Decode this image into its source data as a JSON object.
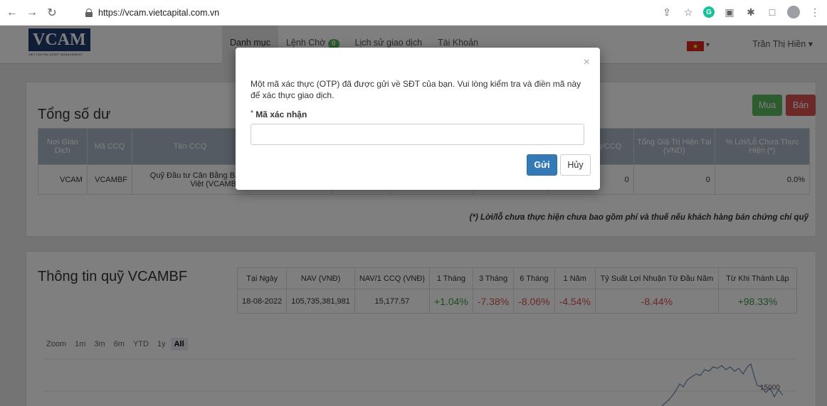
{
  "browser": {
    "url": "https://vcam.vietcapital.com.vn",
    "icons": [
      "back-icon",
      "forward-icon",
      "reload-icon",
      "share-icon",
      "star-icon",
      "grammarly-icon",
      "extension-icon",
      "puzzle-icon",
      "sidebar-icon",
      "profile-icon",
      "menu-icon"
    ]
  },
  "navbar": {
    "logo": "VCAM",
    "logo_tagline": "VIET CAPITAL ASSET MANAGEMENT",
    "menu": [
      {
        "label": "Danh mục"
      },
      {
        "label": "Lệnh Chờ",
        "badge": "0"
      },
      {
        "label": "Lịch sử giao dịch"
      },
      {
        "label": "Tài Khoản"
      }
    ],
    "user_name": "Trần Thị Hiền"
  },
  "balance": {
    "title": "Tổng số dư",
    "buy_label": "Mua",
    "sell_label": "Bán",
    "headers": [
      "Nơi Giao Dịch",
      "Mã CCQ",
      "Tên CCQ",
      "",
      "",
      "",
      "",
      "Giá Trị TS g/CCQ",
      "Tổng Giá Trị Hiện Tại (VND)",
      "% Lời/Lỗ Chưa Thực Hiện (*)"
    ],
    "rows": [
      [
        "VCAM",
        "VCAMBF",
        "Quỹ Đầu tư Cân Bằng Bản Việt (VCAMBF)",
        "",
        "",
        "",
        "",
        "0",
        "0",
        "0.0%"
      ]
    ],
    "note": "(*) Lời/lỗ chưa thực hiện chưa bao gồm phí và thuế nếu khách hàng bán chứng chỉ quỹ"
  },
  "fund_info": {
    "title": "Thông tin quỹ VCAMBF",
    "headers": [
      "Tại Ngày",
      "NAV (VNĐ)",
      "NAV/1 CCQ (VNĐ)",
      "1 Tháng",
      "3 Tháng",
      "6 Tháng",
      "1 Năm",
      "Tỷ Suất Lợi Nhuận Từ Đầu Năm",
      "Từ Khi Thành Lập"
    ],
    "row": {
      "date": "18-08-2022",
      "nav": "105,735,381,981",
      "nav_per": "15,177.57",
      "m1": "+1.04%",
      "m3": "-7.38%",
      "m6": "-8.06%",
      "y1": "-4.54%",
      "ytd": "-8.44%",
      "inception": "+98.33%"
    },
    "zoom_label": "Zoom",
    "zoom_options": [
      "1m",
      "3m",
      "6m",
      "YTD",
      "1y",
      "All"
    ],
    "chart_tick": "15000"
  },
  "modal": {
    "message": "Một mã xác thực (OTP) đã được gửi về SĐT của bạn. Vui lòng kiểm tra và điền mã này để xác thực giao dịch.",
    "required_mark": "*",
    "field_label": "Mã xác nhận",
    "otp_value": "",
    "send_label": "Gửi",
    "cancel_label": "Hủy",
    "close_symbol": "×"
  }
}
